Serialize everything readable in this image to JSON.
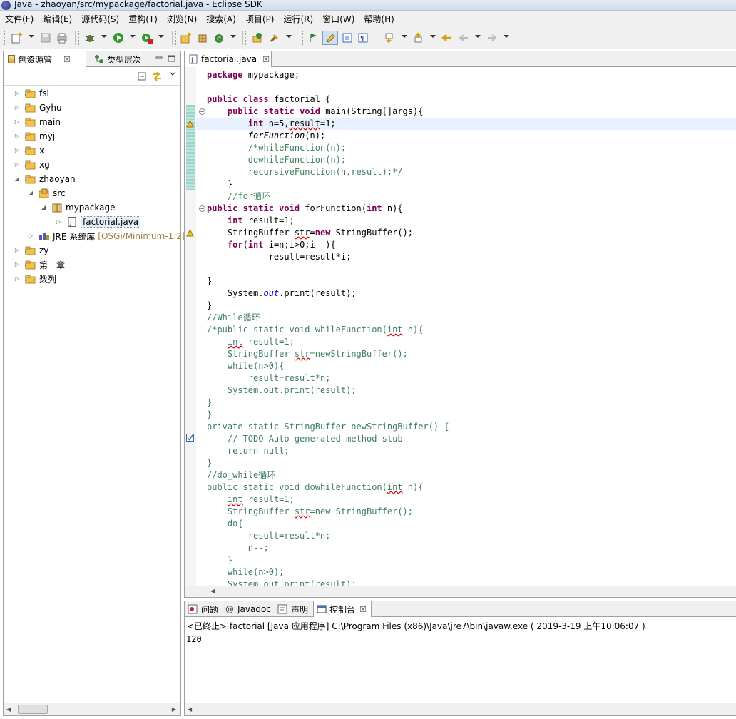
{
  "window": {
    "title": "Java  -  zhaoyan/src/mypackage/factorial.java  -  Eclipse SDK"
  },
  "menu": [
    "文件(F)",
    "编辑(E)",
    "源代码(S)",
    "重构(T)",
    "浏览(N)",
    "搜索(A)",
    "项目(P)",
    "运行(R)",
    "窗口(W)",
    "帮助(H)"
  ],
  "left_panel": {
    "tabs": [
      {
        "label": "包资源管"
      },
      {
        "label": "类型层次"
      }
    ],
    "close_symbol": "☒",
    "tree": [
      {
        "label": "fsl",
        "level": 0,
        "icon": "project"
      },
      {
        "label": "Gyhu",
        "level": 0,
        "icon": "project"
      },
      {
        "label": "main",
        "level": 0,
        "icon": "project"
      },
      {
        "label": "myj",
        "level": 0,
        "icon": "project"
      },
      {
        "label": "x",
        "level": 0,
        "icon": "project"
      },
      {
        "label": "xg",
        "level": 0,
        "icon": "project"
      },
      {
        "label": "zhaoyan",
        "level": 0,
        "icon": "project"
      },
      {
        "label": "src",
        "level": 1,
        "icon": "source-folder"
      },
      {
        "label": "mypackage",
        "level": 2,
        "icon": "package"
      },
      {
        "label": "factorial.java",
        "level": 3,
        "icon": "java-file"
      },
      {
        "label": "JRE 系统库",
        "suffix": "[OSGi/Minimum-1.2]",
        "level": 1,
        "icon": "library"
      },
      {
        "label": "zy",
        "level": 0,
        "icon": "project"
      },
      {
        "label": "第一章",
        "level": 0,
        "icon": "project"
      },
      {
        "label": "数列",
        "level": 0,
        "icon": "project"
      }
    ]
  },
  "editor": {
    "tab": "factorial.java",
    "lines": [
      [
        {
          "t": "package ",
          "c": "kw"
        },
        {
          "t": "mypackage;"
        }
      ],
      [],
      [
        {
          "t": "public ",
          "c": "kw"
        },
        {
          "t": "class ",
          "c": "kw"
        },
        {
          "t": "factorial {"
        }
      ],
      [
        {
          "t": "    "
        },
        {
          "t": "public ",
          "c": "kw"
        },
        {
          "t": "static ",
          "c": "kw"
        },
        {
          "t": "void ",
          "c": "kw"
        },
        {
          "t": "main(String[]args){"
        }
      ],
      [
        {
          "t": "        "
        },
        {
          "t": "int ",
          "c": "kw"
        },
        {
          "t": "n=5,"
        },
        {
          "t": "result",
          "c": "squig"
        },
        {
          "t": "=1;"
        }
      ],
      [
        {
          "t": "        "
        },
        {
          "t": "forFunction",
          "c": "it"
        },
        {
          "t": "(n);"
        }
      ],
      [
        {
          "t": "        "
        },
        {
          "t": "/*whileFunction(n);",
          "c": "cm"
        }
      ],
      [
        {
          "t": "        "
        },
        {
          "t": "dowhileFunction(n);",
          "c": "cm"
        }
      ],
      [
        {
          "t": "        "
        },
        {
          "t": "recursiveFunction(n,result);*/",
          "c": "cm"
        }
      ],
      [
        {
          "t": "    }"
        }
      ],
      [
        {
          "t": "    "
        },
        {
          "t": "//for循环",
          "c": "cm"
        }
      ],
      [
        {
          "t": "public ",
          "c": "kw"
        },
        {
          "t": "static ",
          "c": "kw"
        },
        {
          "t": "void ",
          "c": "kw"
        },
        {
          "t": "forFunction("
        },
        {
          "t": "int ",
          "c": "kw"
        },
        {
          "t": "n){"
        }
      ],
      [
        {
          "t": "    "
        },
        {
          "t": "int ",
          "c": "kw"
        },
        {
          "t": "result=1;"
        }
      ],
      [
        {
          "t": "    StringBuffer "
        },
        {
          "t": "str",
          "c": "squig"
        },
        {
          "t": "="
        },
        {
          "t": "new ",
          "c": "kw"
        },
        {
          "t": "StringBuffer();"
        }
      ],
      [
        {
          "t": "    "
        },
        {
          "t": "for",
          "c": "kw"
        },
        {
          "t": "("
        },
        {
          "t": "int ",
          "c": "kw"
        },
        {
          "t": "i=n;i>0;i--){"
        }
      ],
      [
        {
          "t": "            result=result*i;"
        }
      ],
      [],
      [
        {
          "t": "}"
        }
      ],
      [
        {
          "t": "    System."
        },
        {
          "t": "out",
          "c": "fld"
        },
        {
          "t": ".print(result);"
        }
      ],
      [
        {
          "t": "}"
        }
      ],
      [
        {
          "t": "//While循环",
          "c": "cm"
        }
      ],
      [
        {
          "t": "/*public static void whileFunction(",
          "c": "cm"
        },
        {
          "t": "int",
          "c": "cm squig"
        },
        {
          "t": " n){",
          "c": "cm"
        }
      ],
      [
        {
          "t": "    ",
          "c": "cm"
        },
        {
          "t": "int",
          "c": "cm squig"
        },
        {
          "t": " result=1;",
          "c": "cm"
        }
      ],
      [
        {
          "t": "    StringBuffer ",
          "c": "cm"
        },
        {
          "t": "str",
          "c": "cm squig"
        },
        {
          "t": "=newStringBuffer();",
          "c": "cm"
        }
      ],
      [
        {
          "t": "    while(n>0){",
          "c": "cm"
        }
      ],
      [
        {
          "t": "        result=result*n;",
          "c": "cm"
        }
      ],
      [
        {
          "t": "    System.out.print(result);",
          "c": "cm"
        }
      ],
      [
        {
          "t": "}",
          "c": "cm"
        }
      ],
      [
        {
          "t": "}",
          "c": "cm"
        }
      ],
      [
        {
          "t": "private static StringBuffer newStringBuffer() {",
          "c": "cm"
        }
      ],
      [
        {
          "t": "    // ",
          "c": "cm"
        },
        {
          "t": "TODO",
          "c": "cm"
        },
        {
          "t": " Auto-generated method stub",
          "c": "cm"
        }
      ],
      [
        {
          "t": "    return null;",
          "c": "cm"
        }
      ],
      [
        {
          "t": "}",
          "c": "cm"
        }
      ],
      [
        {
          "t": "//do_while循环",
          "c": "cm"
        }
      ],
      [
        {
          "t": "public static void dowhileFunction(",
          "c": "cm"
        },
        {
          "t": "int",
          "c": "cm squig"
        },
        {
          "t": " n){",
          "c": "cm"
        }
      ],
      [
        {
          "t": "    ",
          "c": "cm"
        },
        {
          "t": "int",
          "c": "cm squig"
        },
        {
          "t": " result=1;",
          "c": "cm"
        }
      ],
      [
        {
          "t": "    StringBuffer ",
          "c": "cm"
        },
        {
          "t": "str",
          "c": "cm squig"
        },
        {
          "t": "=new StringBuffer();",
          "c": "cm"
        }
      ],
      [
        {
          "t": "    do{",
          "c": "cm"
        }
      ],
      [
        {
          "t": "        result=result*n;",
          "c": "cm"
        }
      ],
      [
        {
          "t": "        n--;",
          "c": "cm"
        }
      ],
      [
        {
          "t": "    }",
          "c": "cm"
        }
      ],
      [
        {
          "t": "    while(n>0);",
          "c": "cm"
        }
      ],
      [
        {
          "t": "    System.out.print(result);",
          "c": "cm"
        }
      ]
    ]
  },
  "console": {
    "tabs": [
      {
        "label": "问题"
      },
      {
        "label": "Javadoc"
      },
      {
        "label": "声明"
      },
      {
        "label": "控制台"
      }
    ],
    "status": "<已终止> factorial [Java 应用程序] C:\\Program Files (x86)\\Java\\jre7\\bin\\javaw.exe ( 2019-3-19 上午10:06:07 )",
    "output": "120"
  }
}
